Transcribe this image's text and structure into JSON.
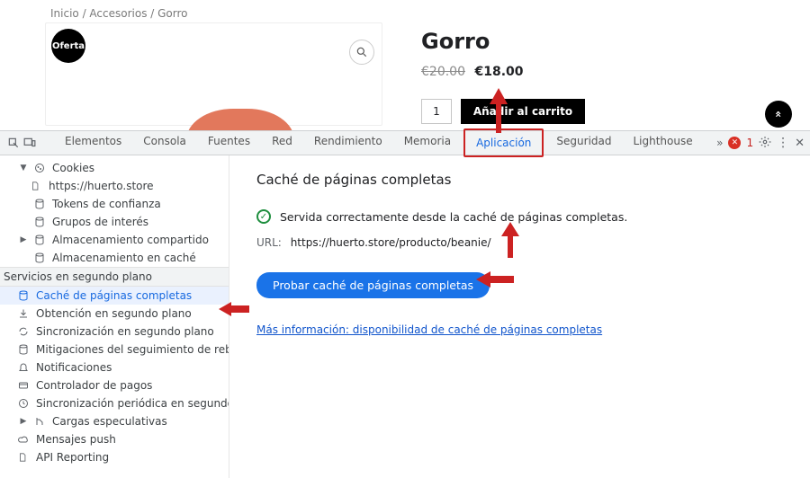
{
  "site": {
    "breadcrumbs": "Inicio / Accesorios / Gorro",
    "sale_badge": "¡Oferta!",
    "title": "Gorro",
    "currency": "€",
    "old_price": "20.00",
    "new_price": "18.00",
    "qty": "1",
    "add_to_cart": "Añadir al carrito",
    "scroll_top_glyph": "«"
  },
  "devtools": {
    "tabs": [
      "Elementos",
      "Consola",
      "Fuentes",
      "Red",
      "Rendimiento",
      "Memoria",
      "Aplicación",
      "Seguridad",
      "Lighthouse"
    ],
    "active_tab": "Aplicación",
    "overflow_glyph": "»",
    "error_count": "1",
    "sidebar": {
      "cookies": "Cookies",
      "cookies_url": "https://huerto.store",
      "trust": "Tokens de confianza",
      "interest": "Grupos de interés",
      "shared": "Almacenamiento compartido",
      "cache": "Almacenamiento en caché",
      "bg_header": "Servicios en segundo plano",
      "bfcache": "Caché de páginas completas",
      "bgfetch": "Obtención en segundo plano",
      "bgsync": "Sincronización en segundo plano",
      "bounce": "Mitigaciones del seguimiento de rebo",
      "notif": "Notificaciones",
      "pay": "Controlador de pagos",
      "psync": "Sincronización periódica en segundo",
      "spec": "Cargas especulativas",
      "push": "Mensajes push",
      "api": "API Reporting"
    },
    "panel": {
      "title": "Caché de páginas completas",
      "served": "Servida correctamente desde la caché de páginas completas.",
      "url_label": "URL:",
      "url_value": "https://huerto.store/producto/beanie/",
      "probe": "Probar caché de páginas completas",
      "more": "Más información: disponibilidad de caché de páginas completas"
    }
  }
}
